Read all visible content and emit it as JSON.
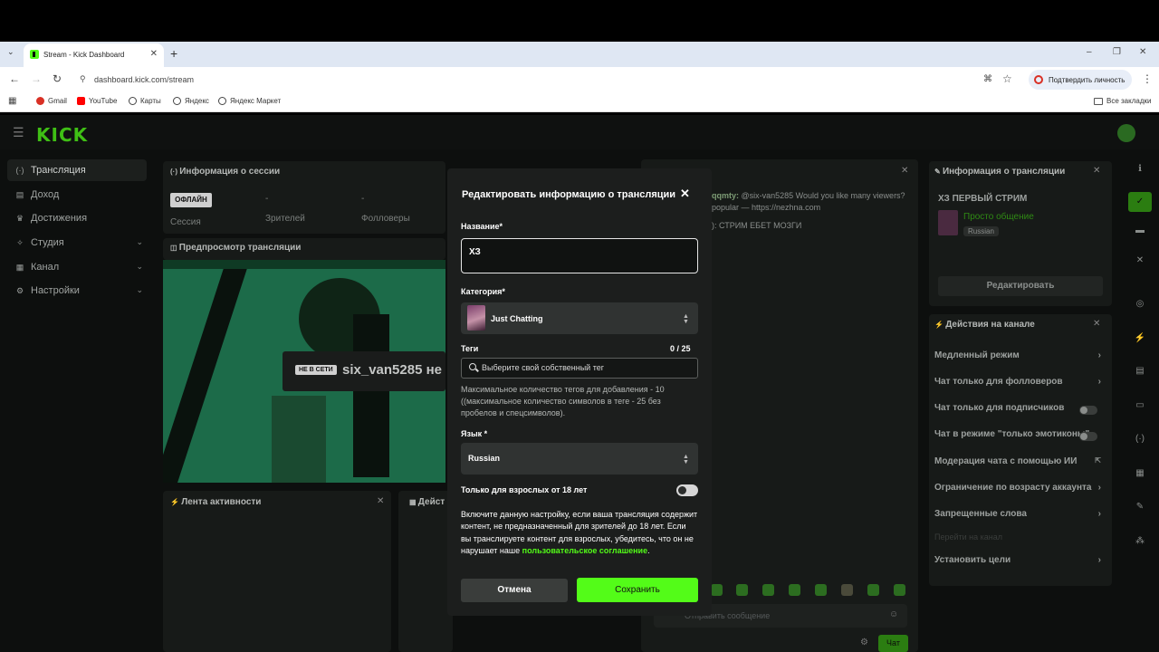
{
  "browser": {
    "tab_title": "Stream - Kick Dashboard",
    "url": "dashboard.kick.com/stream",
    "verify_pill": "Подтвердить личность",
    "bookmarks": [
      {
        "label": "Gmail",
        "color": "#d93025"
      },
      {
        "label": "YouTube",
        "color": "#ff0000"
      },
      {
        "label": "Карты",
        "color": "#444444"
      },
      {
        "label": "Яндекс",
        "color": "#444444"
      },
      {
        "label": "Яндекс Маркет",
        "color": "#444444"
      }
    ],
    "all_bookmarks": "Все закладки"
  },
  "dashboard": {
    "logo": "KICK",
    "sidebar": [
      {
        "label": "Трансляция",
        "icon": "(·)",
        "active": true
      },
      {
        "label": "Доход",
        "icon": "▤"
      },
      {
        "label": "Достижения",
        "icon": "♛"
      },
      {
        "label": "Студия",
        "icon": "✧",
        "chevron": true
      },
      {
        "label": "Канал",
        "icon": "▦",
        "chevron": true
      },
      {
        "label": "Настройки",
        "icon": "⚙",
        "chevron": true
      }
    ],
    "session": {
      "title": "Информация о сессии",
      "status": "ОФЛАЙН",
      "cols": [
        {
          "value": "",
          "label": "Сессия"
        },
        {
          "value": "-",
          "label": "Зрителей"
        },
        {
          "value": "-",
          "label": "Фолловеры"
        }
      ]
    },
    "preview": {
      "title": "Предпросмотр трансляции",
      "offline_badge": "НЕ В СЕТИ",
      "channel": "six_van5285 не"
    },
    "activity_title": "Лента активности",
    "actions_short": "Дейст",
    "chat": {
      "msg1_user": "qqmty:",
      "msg1": "@six-van5285 Would you like many viewers?",
      "msg1_cont": "popular — https://nezhna.com",
      "msg2": "): СТРИМ ЕБЕТ МОЗГИ",
      "input_placeholder": "Отправить сообщение",
      "send": "Чат"
    },
    "stream_info": {
      "title": "Информация о трансляции",
      "stream_title": "ХЗ ПЕРВЫЙ СТРИМ",
      "category": "Просто общение",
      "language": "Russian",
      "edit_button": "Редактировать"
    },
    "channel_actions": {
      "title": "Действия на канале",
      "items": [
        {
          "label": "Медленный режим",
          "type": "chevron"
        },
        {
          "label": "Чат только для фолловеров",
          "type": "chevron"
        },
        {
          "label": "Чат только для подписчиков",
          "type": "toggle"
        },
        {
          "label": "Чат в режиме \"только эмотиконы\"",
          "type": "toggle"
        },
        {
          "label": "Модерация чата с помощью ИИ",
          "type": "ext"
        },
        {
          "label": "Ограничение по возрасту аккаунта",
          "type": "chevron"
        },
        {
          "label": "Запрещенные слова",
          "type": "chevron"
        },
        {
          "label": "Перейти на канал",
          "type": "dim"
        },
        {
          "label": "Установить цели",
          "type": "chevron"
        }
      ]
    }
  },
  "modal": {
    "title": "Редактировать информацию о трансляции",
    "name_label": "Название*",
    "name_value": "ХЗ",
    "category_label": "Категория*",
    "category_value": "Just Chatting",
    "tags_label": "Теги",
    "tags_count": "0 / 25",
    "tags_placeholder": "Выберите свой собственный тег",
    "tags_hint": "Максимальное количество тегов для добавления - 10 ((максимальное количество символов в теге - 25 без пробелов и спецсимволов).",
    "language_label": "Язык *",
    "language_value": "Russian",
    "adult_label": "Только для взрослых от 18 лет",
    "adult_enabled": false,
    "adult_desc": "Включите данную настройку, если ваша трансляция содержит контент, не предназначенный для зрителей до 18 лет. Если вы транслируете контент для взрослых, убедитесь, что он не нарушает наше",
    "adult_link": "пользовательское соглашение",
    "adult_dot": ".",
    "cancel": "Отмена",
    "save": "Сохранить"
  },
  "colors": {
    "accent": "#53fc18"
  }
}
